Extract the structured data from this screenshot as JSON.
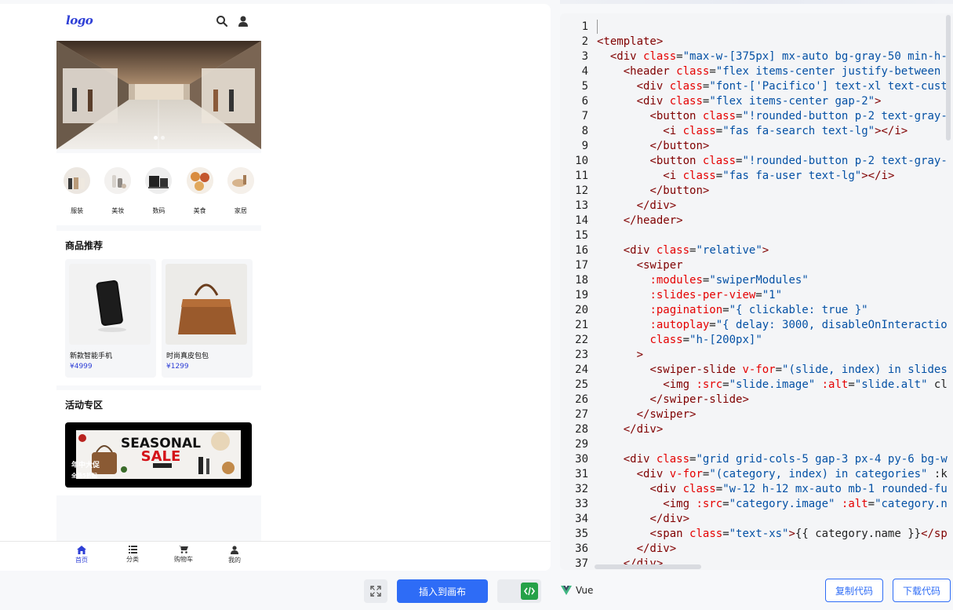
{
  "preview": {
    "logo": "logo",
    "categories": [
      {
        "name": "服装"
      },
      {
        "name": "美妆"
      },
      {
        "name": "数码"
      },
      {
        "name": "美食"
      },
      {
        "name": "家居"
      }
    ],
    "recommend_title": "商品推荐",
    "products": [
      {
        "name": "新款智能手机",
        "price": "¥4999"
      },
      {
        "name": "时尚真皮包包",
        "price": "¥1299"
      }
    ],
    "promo_title": "活动专区",
    "promo": {
      "headline1": "SEASONAL",
      "headline2": "SALE",
      "tag": "年中大促",
      "subtag": "全场5折起"
    },
    "tabs": [
      {
        "label": "首页",
        "icon": "home-icon"
      },
      {
        "label": "分类",
        "icon": "list-icon"
      },
      {
        "label": "购物车",
        "icon": "cart-icon"
      },
      {
        "label": "我的",
        "icon": "user-icon"
      }
    ],
    "accent": "#2e3fd6"
  },
  "editor": {
    "line_numbers": [
      "1",
      "2",
      "3",
      "4",
      "5",
      "6",
      "7",
      "8",
      "9",
      "10",
      "11",
      "12",
      "13",
      "14",
      "15",
      "16",
      "17",
      "18",
      "19",
      "20",
      "21",
      "22",
      "23",
      "24",
      "25",
      "26",
      "27",
      "28",
      "29",
      "30",
      "31",
      "32",
      "33",
      "34",
      "35",
      "36",
      "37"
    ],
    "lines": [
      "",
      "<template>",
      "  <div class=\"max-w-[375px] mx-auto bg-gray-50 min-h-",
      "    <header class=\"flex items-center justify-between",
      "      <div class=\"font-['Pacifico'] text-xl text-cust",
      "      <div class=\"flex items-center gap-2\">",
      "        <button class=\"!rounded-button p-2 text-gray-",
      "          <i class=\"fas fa-search text-lg\"></i>",
      "        </button>",
      "        <button class=\"!rounded-button p-2 text-gray-",
      "          <i class=\"fas fa-user text-lg\"></i>",
      "        </button>",
      "      </div>",
      "    </header>",
      "",
      "    <div class=\"relative\">",
      "      <swiper",
      "        :modules=\"swiperModules\"",
      "        :slides-per-view=\"1\"",
      "        :pagination=\"{ clickable: true }\"",
      "        :autoplay=\"{ delay: 3000, disableOnInteractio",
      "        class=\"h-[200px]\"",
      "      >",
      "        <swiper-slide v-for=\"(slide, index) in slides",
      "          <img :src=\"slide.image\" :alt=\"slide.alt\" cl",
      "        </swiper-slide>",
      "      </swiper>",
      "    </div>",
      "",
      "    <div class=\"grid grid-cols-5 gap-3 px-4 py-6 bg-w",
      "      <div v-for=\"(category, index) in categories\" :k",
      "        <div class=\"w-12 h-12 mx-auto mb-1 rounded-fu",
      "          <img :src=\"category.image\" :alt=\"category.n",
      "        </div>",
      "        <span class=\"text-xs\">{{ category.name }}</sp",
      "      </div>",
      "    </div>"
    ]
  },
  "actions": {
    "insert_label": "插入到画布",
    "framework": "Vue",
    "copy_label": "复制代码",
    "download_label": "下载代码"
  }
}
